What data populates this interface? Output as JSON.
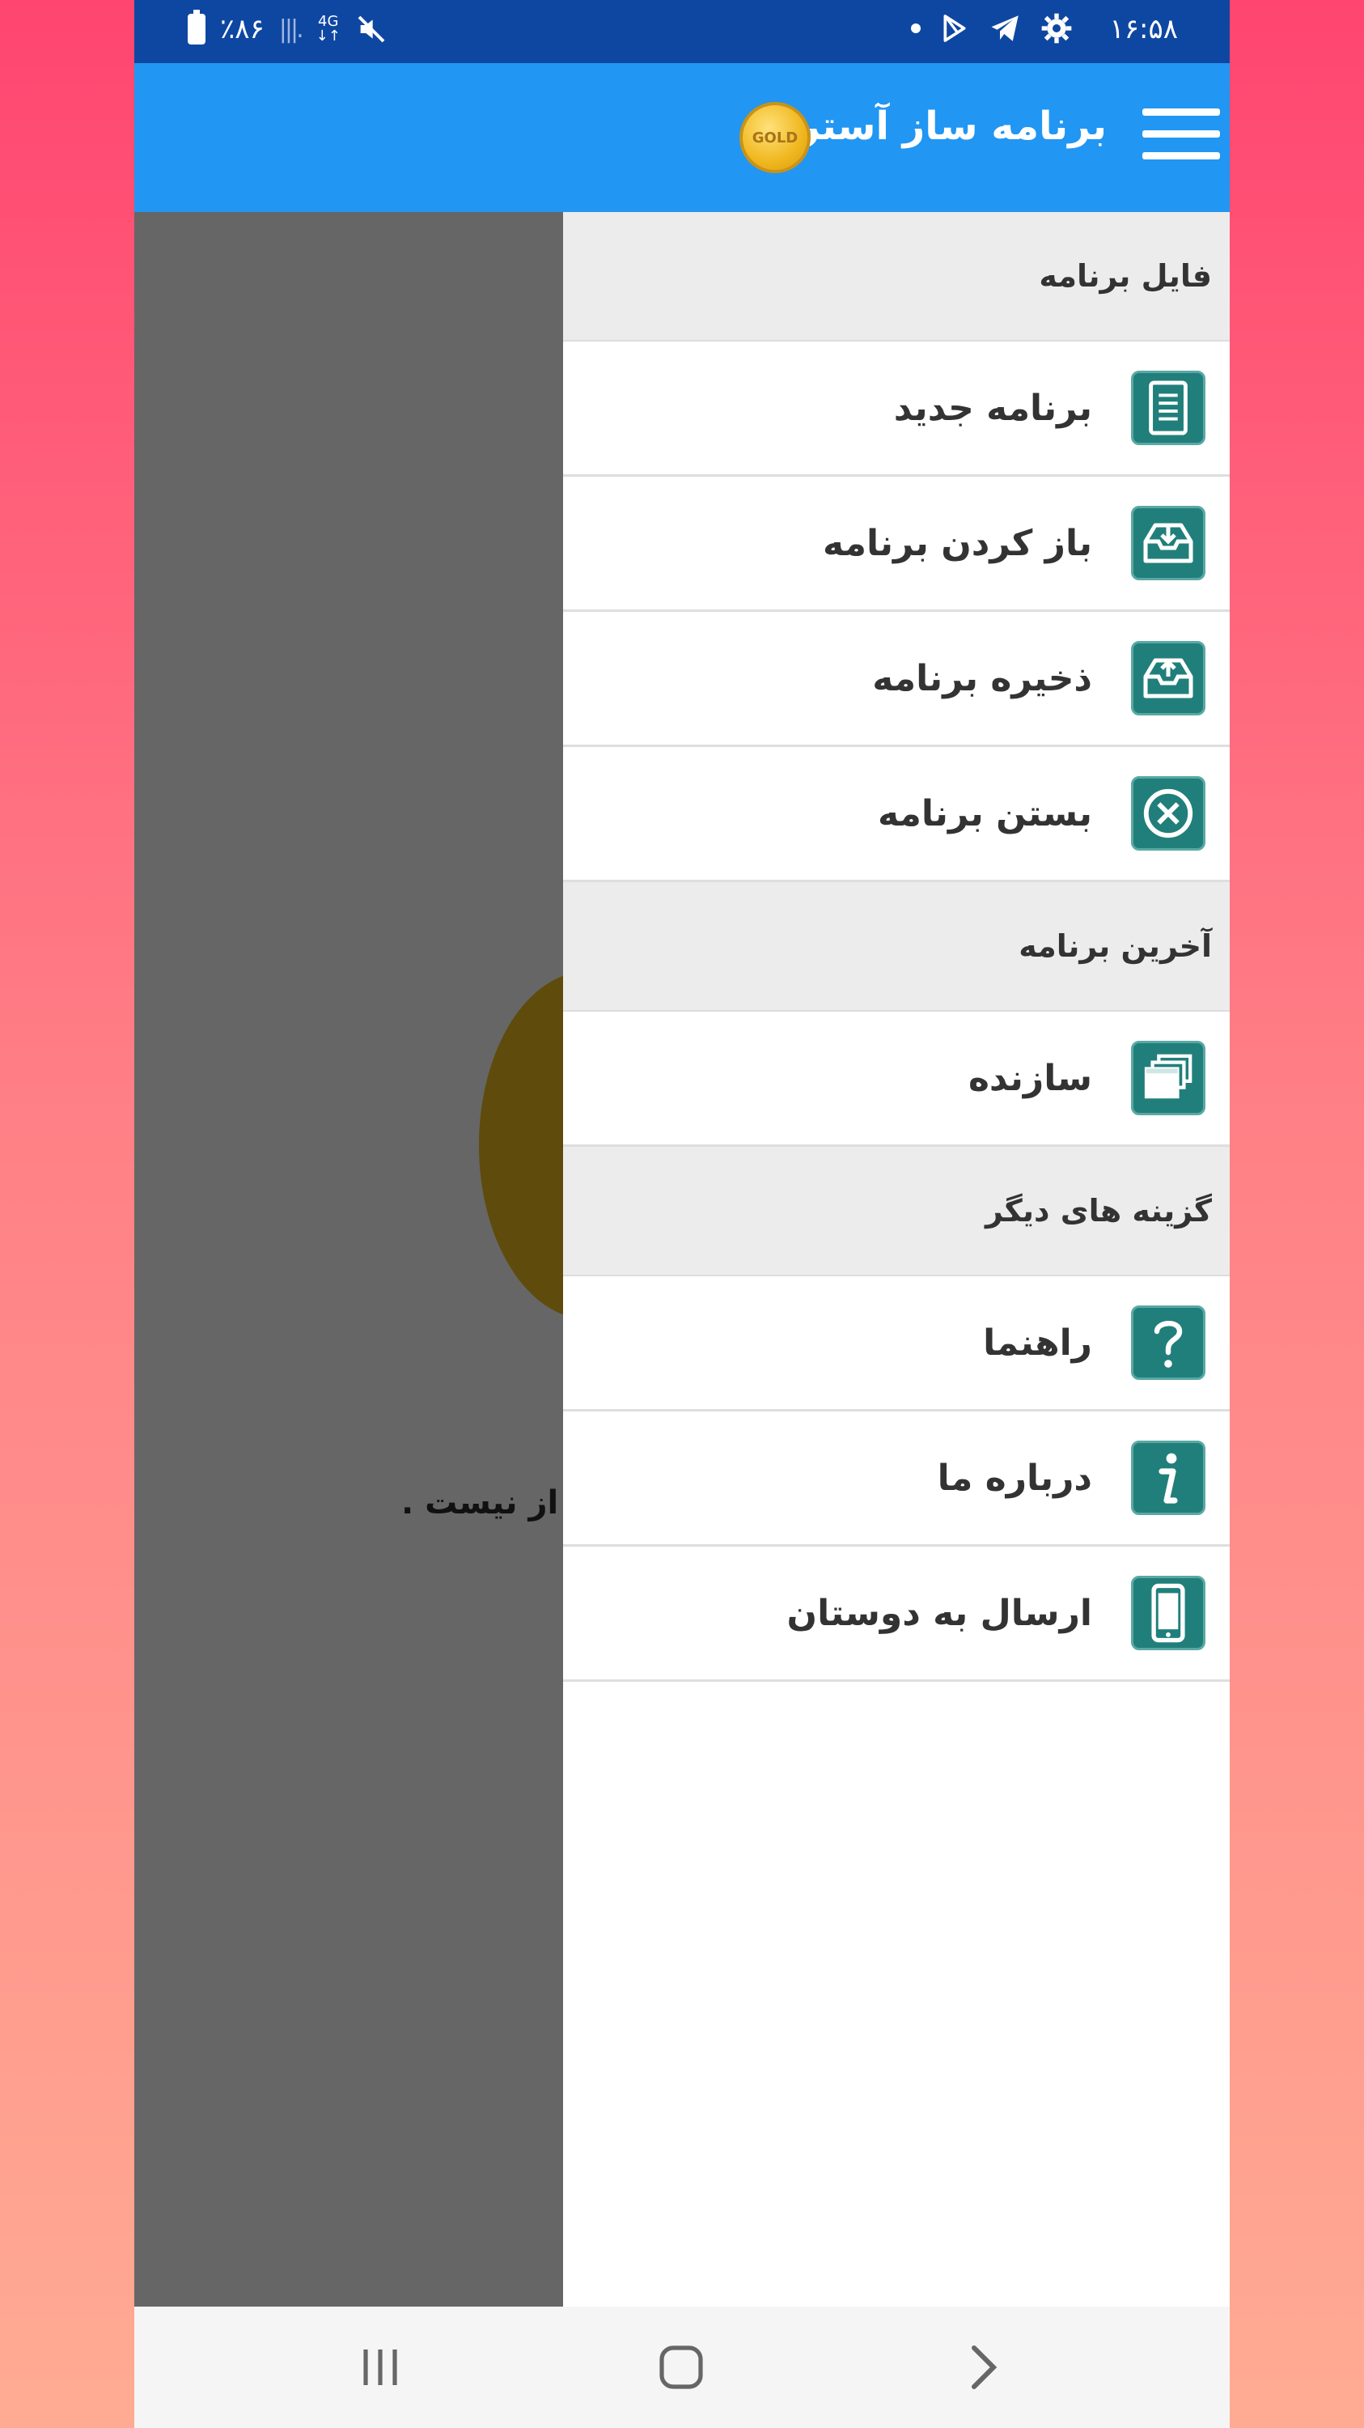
{
  "status_bar": {
    "time": "۱۶:۵۸",
    "battery": "٪۸۶",
    "network": "4G"
  },
  "app_bar": {
    "title": "برنامه ساز آسترا",
    "badge": "GOLD"
  },
  "background": {
    "partial_text": "از نیست ."
  },
  "drawer": {
    "sections": [
      {
        "header": "فایل برنامه",
        "items": [
          {
            "label": "برنامه جدید",
            "icon": "document-icon"
          },
          {
            "label": "باز کردن برنامه",
            "icon": "inbox-download-icon"
          },
          {
            "label": "ذخیره  برنامه",
            "icon": "inbox-upload-icon"
          },
          {
            "label": "بستن برنامه",
            "icon": "close-circle-icon"
          }
        ]
      },
      {
        "header": "آخرین برنامه",
        "items": [
          {
            "label": "سازنده",
            "icon": "stacked-windows-icon"
          }
        ]
      },
      {
        "header": "گزینه های دیگر",
        "items": [
          {
            "label": "راهنما",
            "icon": "question-icon"
          },
          {
            "label": "درباره ما",
            "icon": "info-icon"
          },
          {
            "label": "ارسال به دوستان",
            "icon": "phone-icon"
          }
        ]
      }
    ]
  },
  "colors": {
    "status_bar": "#0e47a1",
    "app_bar": "#2196f3",
    "icon_bg": "#217f7b",
    "section_bg": "#ececec"
  }
}
